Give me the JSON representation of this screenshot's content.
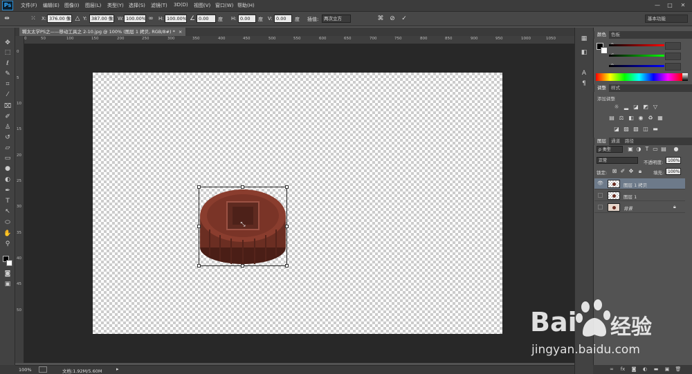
{
  "app": {
    "logo": "Ps",
    "menu": [
      "文件(F)",
      "编辑(E)",
      "图像(I)",
      "图层(L)",
      "类型(Y)",
      "选择(S)",
      "滤镜(T)",
      "3D(D)",
      "视图(V)",
      "窗口(W)",
      "帮助(H)"
    ],
    "window_buttons": [
      "—",
      "□",
      "✕"
    ]
  },
  "options": {
    "x_label": "X:",
    "x_value": "376.00 像素",
    "y_label": "Y:",
    "y_value": "387.00 像素",
    "w_label": "W:",
    "w_value": "100.00%",
    "h_label": "H:",
    "h_value": "100.00%",
    "angle_value": "0.00",
    "angle_unit": "度",
    "hskew_label": "H:",
    "hskew_value": "0.00",
    "hskew_unit": "度",
    "vskew_label": "V:",
    "vskew_value": "0.00",
    "vskew_unit": "度",
    "interp_label": "插值:",
    "interp_value": "两次立方",
    "workspace": "基本功能"
  },
  "document": {
    "tab_title": "糊太太学PS之——移动工具之 2-10.jpg @ 100% (图层 1 拷贝, RGB/8#) *",
    "tab_close": "×",
    "ruler_top": [
      "0",
      "50",
      "100",
      "150",
      "200",
      "250",
      "300",
      "350",
      "400",
      "450",
      "500",
      "550",
      "600",
      "650",
      "700",
      "750",
      "800",
      "850",
      "900",
      "950",
      "1000",
      "1050"
    ],
    "ruler_left": [
      "0",
      "5",
      "10",
      "15",
      "20",
      "25",
      "30",
      "35",
      "40",
      "45",
      "50"
    ],
    "zoom": "100%",
    "doc_info": "文档:1.92M/5.60M"
  },
  "panels": {
    "color_tabs": [
      "颜色",
      "色板"
    ],
    "channels": [
      "R",
      "G",
      "B"
    ],
    "adjust_tabs": [
      "调整",
      "样式"
    ],
    "adjust_title": "添加调整",
    "layers_tabs": [
      "图层",
      "通道",
      "路径"
    ],
    "filter_kind": "ρ 类型",
    "blend_mode": "正常",
    "opacity_label": "不透明度:",
    "opacity_value": "100%",
    "lock_label": "锁定:",
    "fill_label": "填充:",
    "fill_value": "100%",
    "layers": [
      {
        "name": "图层 1 拷贝",
        "visible": true,
        "selected": true
      },
      {
        "name": "图层 1",
        "visible": false,
        "selected": false
      },
      {
        "name": "背景",
        "visible": false,
        "selected": false,
        "locked": true
      }
    ]
  },
  "watermark": {
    "brand_left": "Bai",
    "brand_right": "经验",
    "url": "jingyan.baidu.com"
  },
  "colors": {
    "accent": "#31a8ff",
    "mooncake": "#6b2e22",
    "selected_layer": "#6d7a8a"
  }
}
